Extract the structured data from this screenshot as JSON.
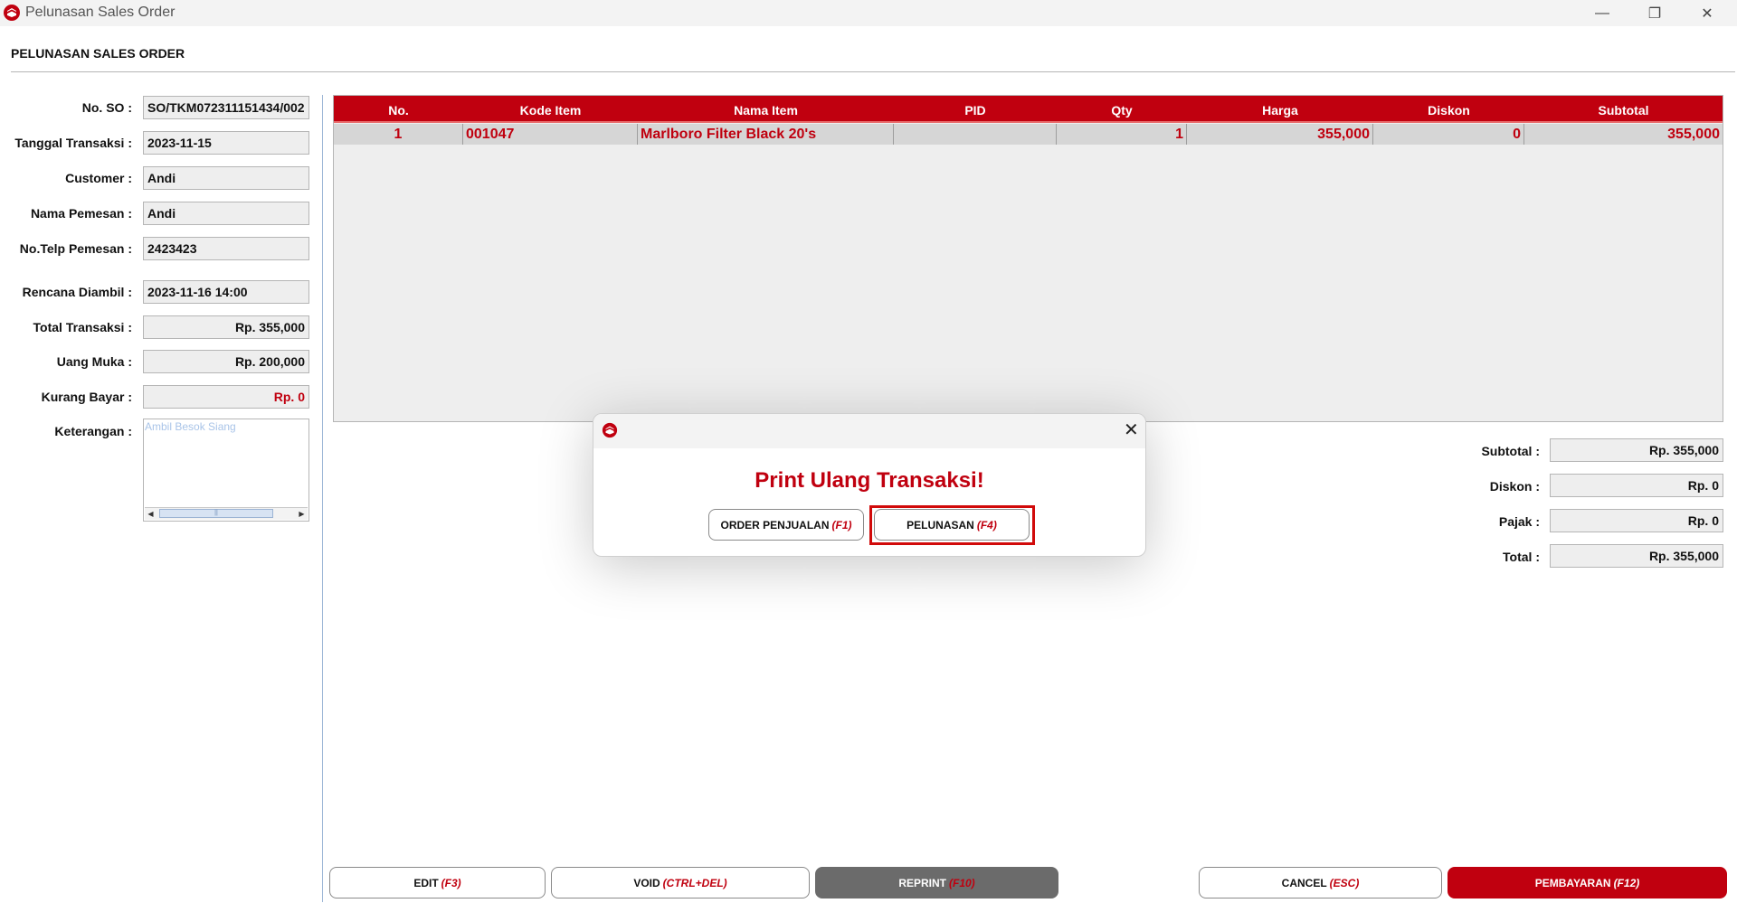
{
  "window": {
    "title": "Pelunasan Sales Order",
    "controls": {
      "minimize": "—",
      "restore": "❐",
      "close": "✕"
    }
  },
  "colors": {
    "accent": "#c0000f",
    "field_bg": "#eeeeee",
    "grid_row": "#d6d6d6"
  },
  "page": {
    "heading": "PELUNASAN SALES ORDER"
  },
  "form": {
    "no_so": {
      "label": "No. SO :",
      "value": "SO/TKM072311151434/002"
    },
    "tanggal": {
      "label": "Tanggal Transaksi :",
      "value": "2023-11-15"
    },
    "customer": {
      "label": "Customer :",
      "value": "Andi"
    },
    "nama_pemesan": {
      "label": "Nama Pemesan :",
      "value": "Andi"
    },
    "telp": {
      "label": "No.Telp Pemesan :",
      "value": "2423423"
    },
    "rencana": {
      "label": "Rencana Diambil :",
      "value": "2023-11-16 14:00"
    },
    "total": {
      "label": "Total Transaksi :",
      "value": "Rp. 355,000"
    },
    "uang_muka": {
      "label": "Uang Muka :",
      "value": "Rp. 200,000"
    },
    "kurang": {
      "label": "Kurang Bayar :",
      "value": "Rp. 0"
    },
    "keterangan": {
      "label": "Keterangan :",
      "placeholder": "Ambil Besok Siang"
    }
  },
  "table": {
    "columns": [
      "No.",
      "Kode Item",
      "Nama Item",
      "PID",
      "Qty",
      "Harga",
      "Diskon",
      "Subtotal"
    ],
    "rows": [
      {
        "no": "1",
        "kode": "001047",
        "nama": "Marlboro Filter Black 20's",
        "pid": "",
        "qty": "1",
        "harga": "355,000",
        "diskon": "0",
        "subtotal": "355,000"
      }
    ]
  },
  "summary": {
    "subtotal": {
      "label": "Subtotal :",
      "value": "Rp. 355,000"
    },
    "diskon": {
      "label": "Diskon :",
      "value": "Rp. 0"
    },
    "pajak": {
      "label": "Pajak :",
      "value": "Rp. 0"
    },
    "total": {
      "label": "Total :",
      "value": "Rp. 355,000"
    }
  },
  "buttons": {
    "edit": {
      "label": "EDIT",
      "key": "(F3)"
    },
    "void": {
      "label": "VOID",
      "key": "(CTRL+DEL)"
    },
    "reprint": {
      "label": "REPRINT",
      "key": "(F10)"
    },
    "cancel": {
      "label": "CANCEL",
      "key": "(ESC)"
    },
    "pembayaran": {
      "label": "PEMBAYARAN",
      "key": "(F12)"
    }
  },
  "dialog": {
    "message": "Print Ulang Transaksi!",
    "close": "✕",
    "order_penjualan": {
      "label": "ORDER PENJUALAN",
      "key": "(F1)"
    },
    "pelunasan": {
      "label": "PELUNASAN",
      "key": "(F4)"
    }
  }
}
